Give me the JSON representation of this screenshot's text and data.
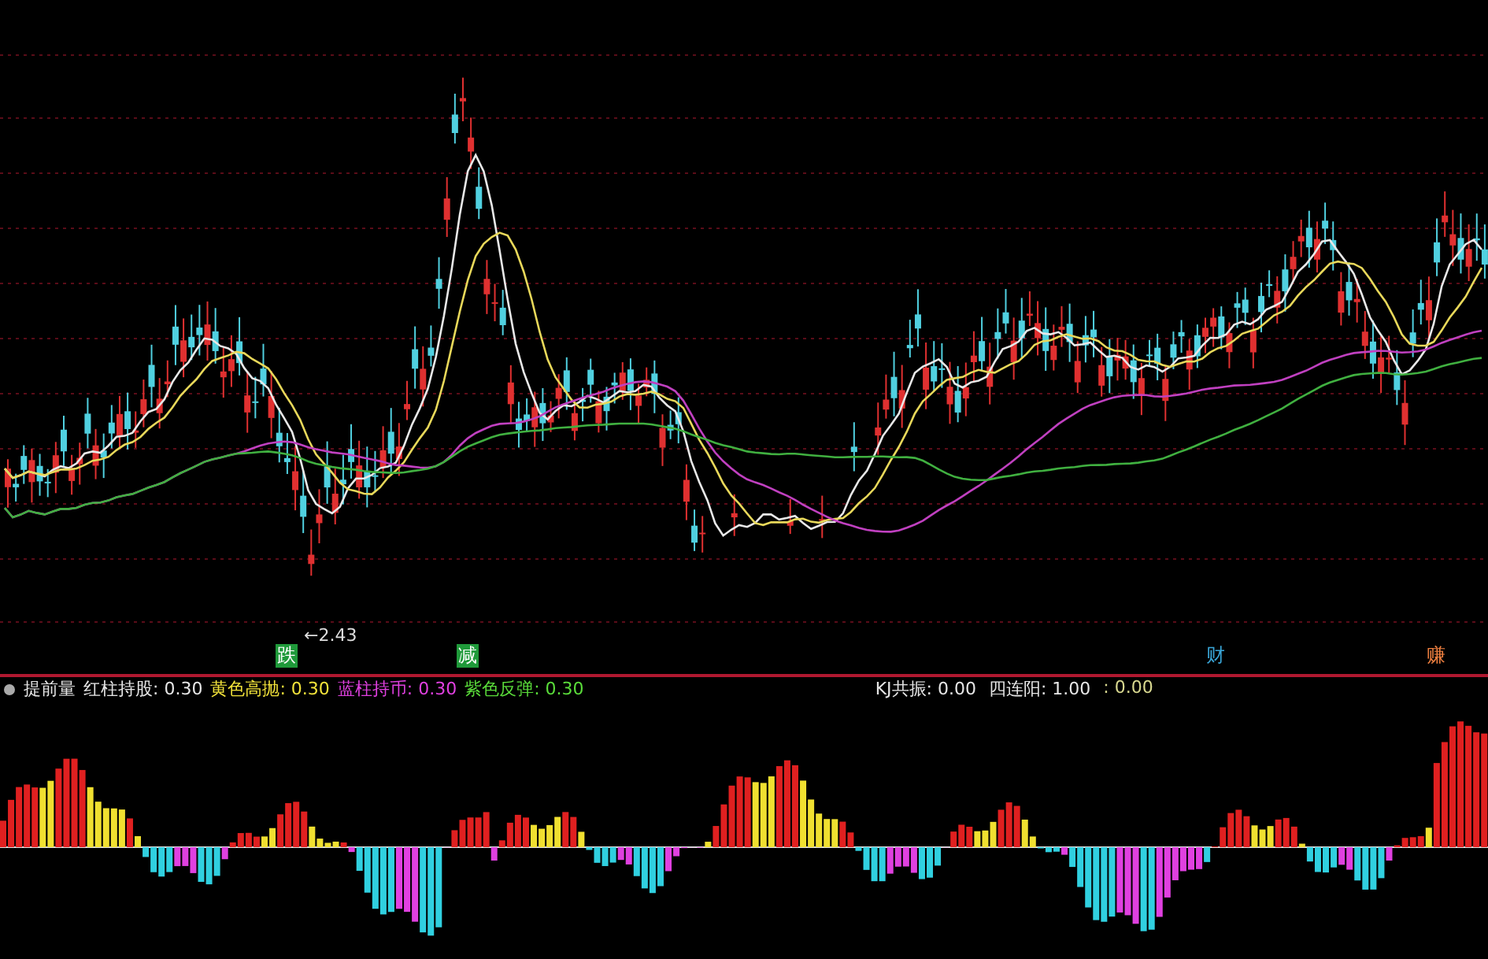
{
  "price_chart": {
    "annotation": "←2.43",
    "signals": [
      {
        "text": "跌",
        "kind": "boxed",
        "color": "#1f9a3a"
      },
      {
        "text": "减",
        "kind": "boxed",
        "color": "#1f9a3a"
      },
      {
        "text": "财",
        "kind": "plain",
        "color": "#3aa6d8"
      },
      {
        "text": "赚",
        "kind": "plain",
        "color": "#f08040"
      }
    ]
  },
  "legend": {
    "title": "提前量",
    "left": [
      {
        "text": "红柱持股: 0.30",
        "color": "#e6e6e6"
      },
      {
        "text": "黄色高抛: 0.30",
        "color": "#f2e23a"
      },
      {
        "text": "蓝柱持币: 0.30",
        "color": "#e040e0"
      },
      {
        "text": "紫色反弹: 0.30",
        "color": "#5adc3a"
      }
    ],
    "right": [
      {
        "text": "KJ共振: 0.00",
        "color": "#e6e6e6"
      },
      {
        "text": "四连阳: 1.00",
        "color": "#e6e6e6"
      },
      {
        "text": ": 0.00",
        "color": "#d8d890"
      }
    ]
  }
}
